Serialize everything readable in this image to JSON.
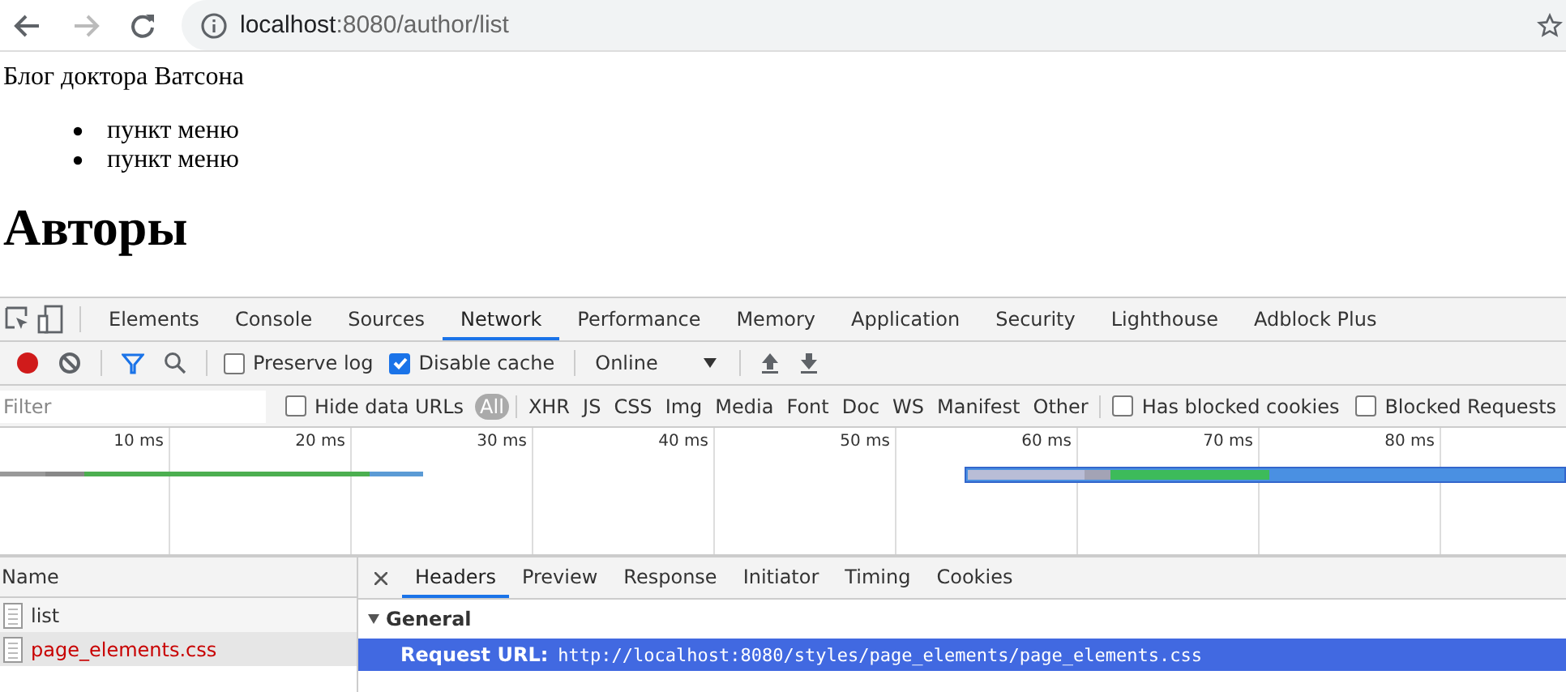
{
  "browser": {
    "url_host": "localhost",
    "url_rest": ":8080/author/list",
    "back_disabled": false,
    "forward_disabled": true,
    "bookmarked": false
  },
  "page": {
    "site_title": "Блог доктора Ватсона",
    "menu": [
      "пункт меню",
      "пункт меню"
    ],
    "heading": "Авторы"
  },
  "devtools": {
    "tabs": [
      {
        "label": "Elements",
        "selected": false
      },
      {
        "label": "Console",
        "selected": false
      },
      {
        "label": "Sources",
        "selected": false
      },
      {
        "label": "Network",
        "selected": true
      },
      {
        "label": "Performance",
        "selected": false
      },
      {
        "label": "Memory",
        "selected": false
      },
      {
        "label": "Application",
        "selected": false
      },
      {
        "label": "Security",
        "selected": false
      },
      {
        "label": "Lighthouse",
        "selected": false
      },
      {
        "label": "Adblock Plus",
        "selected": false
      }
    ],
    "toolbar": {
      "recording": true,
      "filter_active": true,
      "preserve_log": {
        "label": "Preserve log",
        "checked": false
      },
      "disable_cache": {
        "label": "Disable cache",
        "checked": true
      },
      "throttling": "Online"
    },
    "filter_bar": {
      "placeholder": "Filter",
      "hide_data_urls": {
        "label": "Hide data URLs",
        "checked": false
      },
      "types": [
        {
          "label": "All",
          "selected": true
        },
        {
          "label": "XHR",
          "selected": false
        },
        {
          "label": "JS",
          "selected": false
        },
        {
          "label": "CSS",
          "selected": false
        },
        {
          "label": "Img",
          "selected": false
        },
        {
          "label": "Media",
          "selected": false
        },
        {
          "label": "Font",
          "selected": false
        },
        {
          "label": "Doc",
          "selected": false
        },
        {
          "label": "WS",
          "selected": false
        },
        {
          "label": "Manifest",
          "selected": false
        },
        {
          "label": "Other",
          "selected": false
        }
      ],
      "has_blocked_cookies": {
        "label": "Has blocked cookies",
        "checked": false
      },
      "blocked_requests": {
        "label": "Blocked Requests",
        "checked": false
      }
    },
    "timeline_ticks": [
      "10 ms",
      "20 ms",
      "30 ms",
      "40 ms",
      "50 ms",
      "60 ms",
      "70 ms",
      "80 ms"
    ],
    "requests": {
      "column": "Name",
      "rows": [
        {
          "name": "list",
          "failed": false,
          "selected": false
        },
        {
          "name": "page_elements.css",
          "failed": true,
          "selected": true
        }
      ]
    },
    "detail": {
      "tabs": [
        {
          "label": "Headers",
          "selected": true
        },
        {
          "label": "Preview",
          "selected": false
        },
        {
          "label": "Response",
          "selected": false
        },
        {
          "label": "Initiator",
          "selected": false
        },
        {
          "label": "Timing",
          "selected": false
        },
        {
          "label": "Cookies",
          "selected": false
        }
      ],
      "section": {
        "title": "General",
        "expanded": true
      },
      "rows": [
        {
          "key": "Request URL:",
          "value": "http://localhost:8080/styles/page_elements/page_elements.css",
          "selected": true
        }
      ]
    }
  }
}
